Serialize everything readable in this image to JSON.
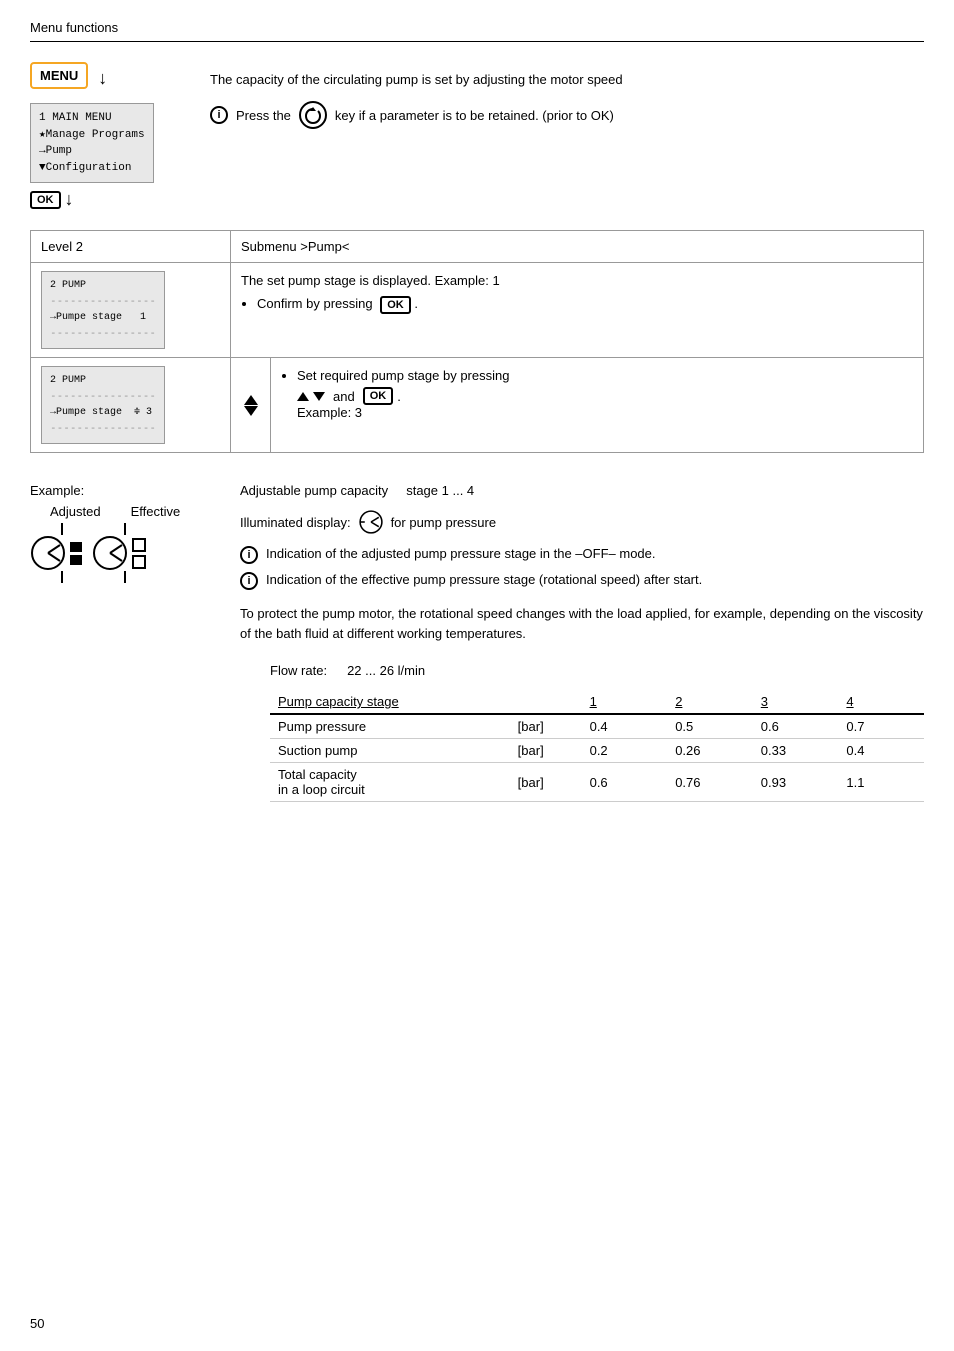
{
  "header": {
    "title": "Menu functions"
  },
  "top_description": {
    "main_text": "The capacity of the circulating pump is set by adjusting the motor speed",
    "info_text": "Press the",
    "info_key": "↺",
    "info_suffix": "key if a parameter is to be retained. (prior to OK)"
  },
  "menu_panel": {
    "label": "MENU",
    "arrow": "↓",
    "lcd_line1": "1 MAIN MENU",
    "lcd_line2": "★Manage Programs",
    "lcd_line3": "→Pump",
    "lcd_line4": "▼Configuration",
    "ok_label": "OK",
    "ok_arrow": "↓"
  },
  "table": {
    "level2_label": "Level 2",
    "submenu_label": "Submenu >Pump<",
    "row1": {
      "left_lcd_line1": "2 PUMP",
      "left_lcd_sep1": "----------------",
      "left_lcd_line2": "→Pumpe stage   1",
      "left_lcd_sep2": "----------------",
      "right_text1": "The set pump stage is displayed. Example: 1",
      "right_bullet1": "Confirm by pressing",
      "right_ok": "OK"
    },
    "row2": {
      "left_lcd_line1": "2 PUMP",
      "left_lcd_sep1": "----------------",
      "left_lcd_line2": "→Pumpe stage  ≑ 3",
      "left_lcd_sep2": "----------------",
      "right_bullet1": "Set required pump stage by pressing",
      "right_and": "and",
      "right_ok": "OK",
      "right_example": "Example: 3"
    }
  },
  "example_section": {
    "title": "Example:",
    "label_adjusted": "Adjusted",
    "label_effective": "Effective",
    "description1": "Adjustable pump capacity",
    "stage_range": "stage 1 ... 4",
    "illuminated_text": "Illuminated display:",
    "illuminated_suffix": "for pump pressure",
    "info1": "Indication of the adjusted pump pressure stage in the –OFF– mode.",
    "info2": "Indication of the effective pump pressure stage (rotational speed) after start.",
    "paragraph": "To protect the pump motor, the rotational speed changes with the load applied, for example, depending on the viscosity of the bath fluid at different working temperatures."
  },
  "flow_table": {
    "flow_label": "Flow rate:",
    "flow_value": "22 ... 26 l/min",
    "col_headers": [
      "Pump capacity stage",
      "",
      "1",
      "2",
      "3",
      "4"
    ],
    "rows": [
      {
        "label": "Pump pressure",
        "unit": "[bar]",
        "v1": "0.4",
        "v2": "0.5",
        "v3": "0.6",
        "v4": "0.7"
      },
      {
        "label": "Suction pump",
        "unit": "[bar]",
        "v1": "0.2",
        "v2": "0.26",
        "v3": "0.33",
        "v4": "0.4"
      },
      {
        "label": "Total capacity",
        "label2": "in a loop circuit",
        "unit": "[bar]",
        "v1": "0.6",
        "v2": "0.76",
        "v3": "0.93",
        "v4": "1.1"
      }
    ]
  },
  "page_number": "50"
}
